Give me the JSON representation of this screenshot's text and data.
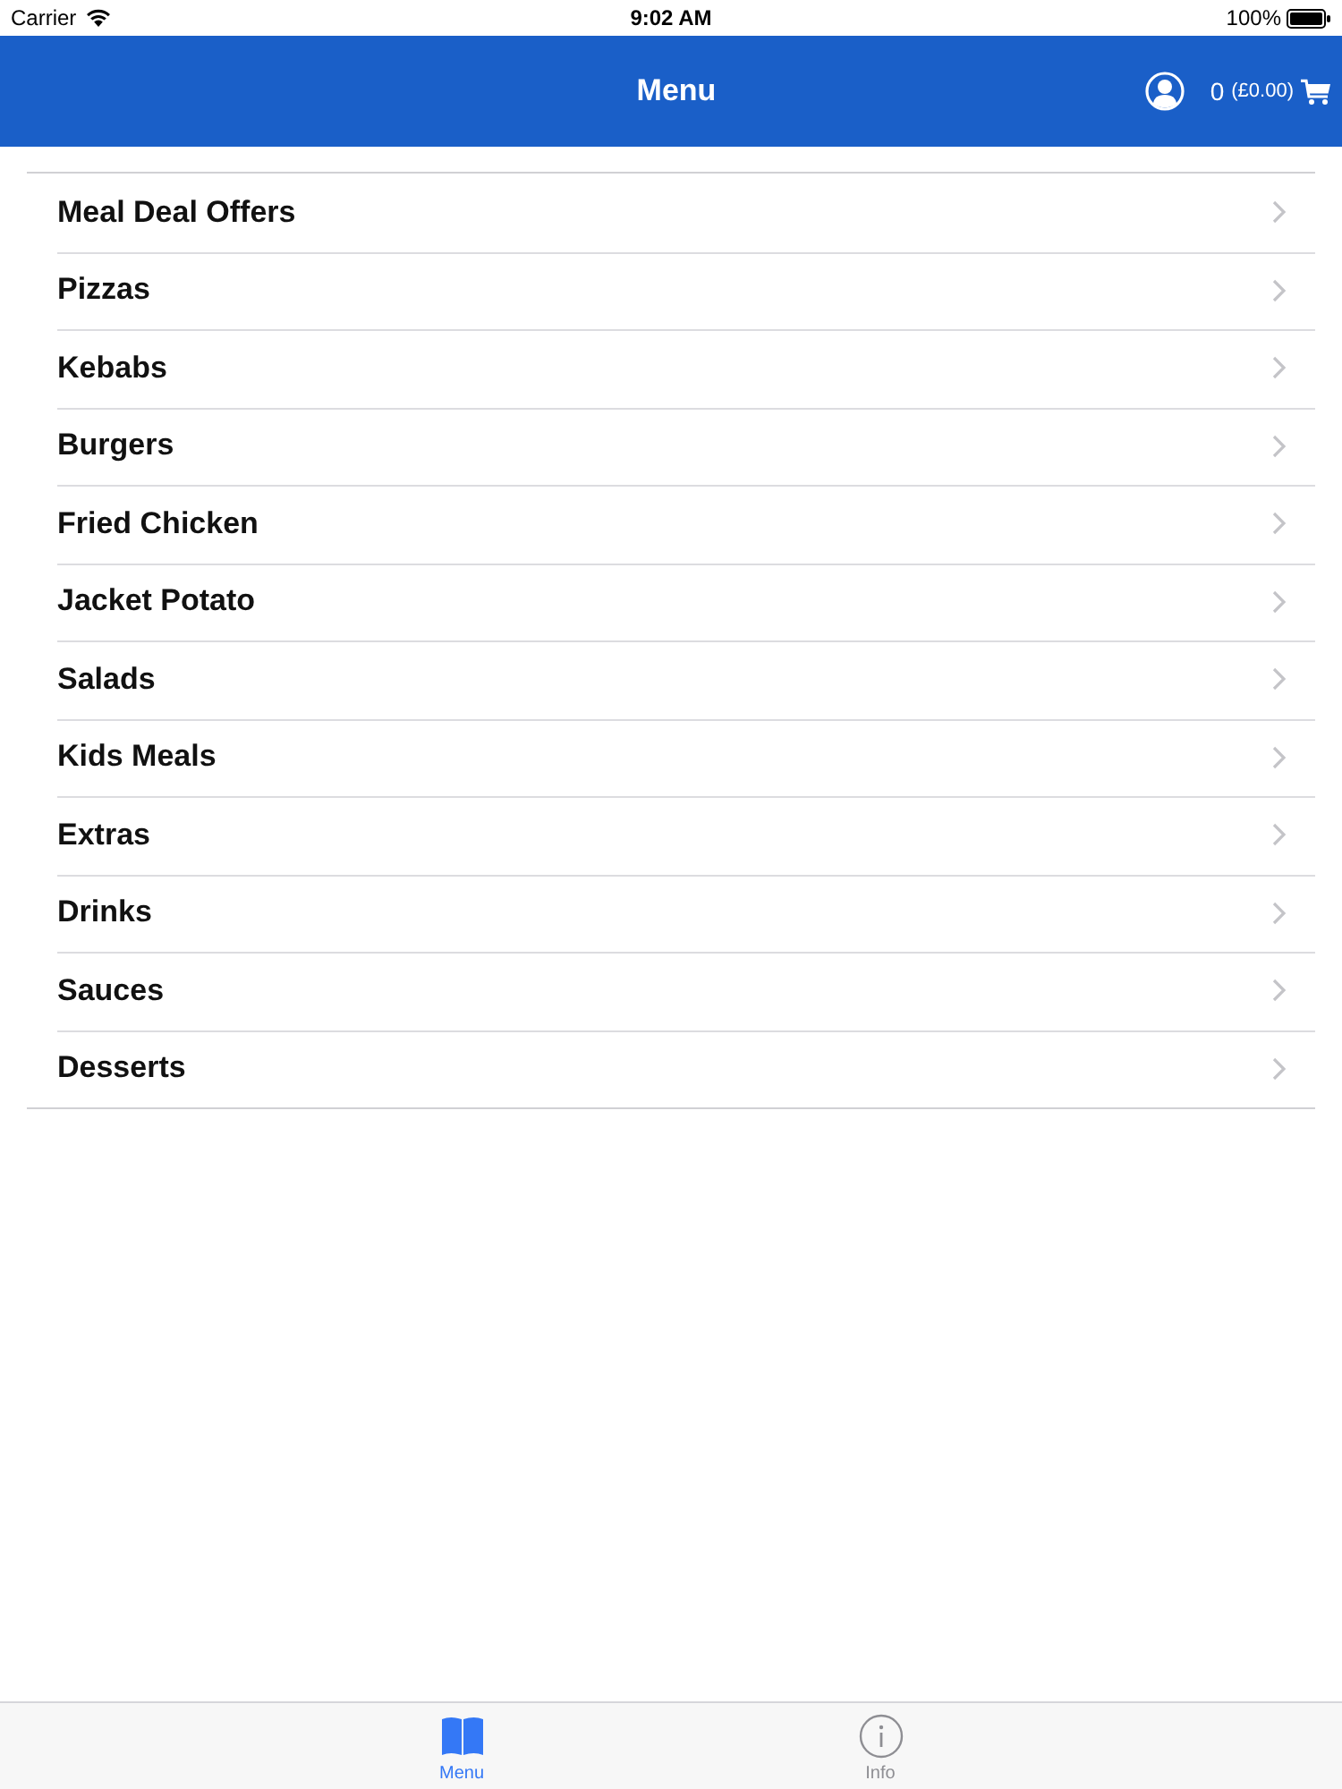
{
  "status_bar": {
    "carrier": "Carrier",
    "time": "9:02 AM",
    "battery": "100%"
  },
  "nav_bar": {
    "title": "Menu",
    "cart": {
      "count": "0",
      "total": "(£0.00)"
    }
  },
  "categories": [
    "Meal Deal Offers",
    "Pizzas",
    "Kebabs",
    "Burgers",
    "Fried Chicken",
    "Jacket Potato",
    "Salads",
    "Kids Meals",
    "Extras",
    "Drinks",
    "Sauces",
    "Desserts"
  ],
  "tab_bar": [
    {
      "label": "Menu",
      "kind": "book",
      "selected": true
    },
    {
      "label": "Info",
      "kind": "info",
      "selected": false
    }
  ]
}
